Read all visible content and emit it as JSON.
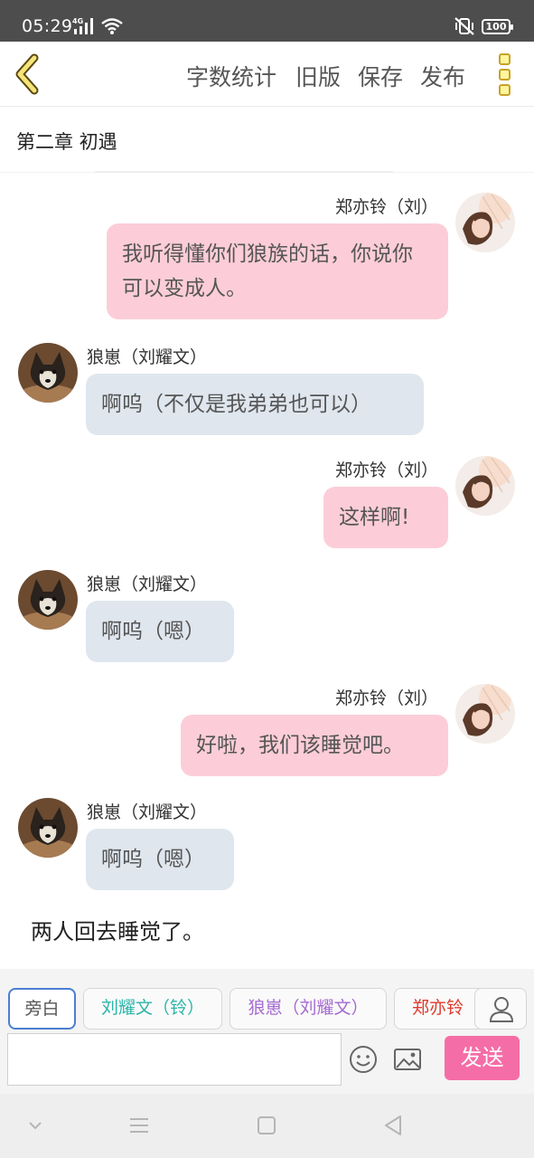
{
  "status_bar": {
    "time": "05:29",
    "network": "4G",
    "battery": "100"
  },
  "toolbar": {
    "word_count": "字数统计",
    "old_version": "旧版",
    "save": "保存",
    "publish": "发布"
  },
  "chapter": {
    "title": "第二章 初遇"
  },
  "messages": [
    {
      "side": "right",
      "sender": "郑亦铃（刘）",
      "text": "我听得懂你们狼族的话，你说你可以变成人。",
      "avatar": "girl-avatar"
    },
    {
      "side": "left",
      "sender": "狼崽（刘耀文）",
      "text": "啊呜（不仅是我弟弟也可以）",
      "avatar": "wolf-pup-avatar"
    },
    {
      "side": "right",
      "sender": "郑亦铃（刘）",
      "text": "这样啊!",
      "avatar": "girl-avatar"
    },
    {
      "side": "left",
      "sender": "狼崽（刘耀文）",
      "text": "啊呜（嗯）",
      "avatar": "wolf-pup-avatar"
    },
    {
      "side": "right",
      "sender": "郑亦铃（刘）",
      "text": "好啦，我们该睡觉吧。",
      "avatar": "girl-avatar"
    },
    {
      "side": "left",
      "sender": "狼崽（刘耀文）",
      "text": "啊呜（嗯）",
      "avatar": "wolf-pup-avatar"
    }
  ],
  "narration": "两人回去睡觉了。",
  "roles": [
    {
      "label": "旁白",
      "color": "#555555",
      "active": true
    },
    {
      "label": "刘耀文（铃）",
      "color": "#2bb5a8",
      "active": false
    },
    {
      "label": "狼崽（刘耀文）",
      "color": "#a46bcf",
      "active": false
    },
    {
      "label": "郑亦铃",
      "color": "#e0392b",
      "active": false
    }
  ],
  "input": {
    "placeholder": "",
    "value": ""
  },
  "send_label": "发送",
  "colors": {
    "accent": "#f56da6",
    "bubble_right": "#fccdd8",
    "bubble_left": "#dfe6ee",
    "back_arrow": "#c9a227"
  }
}
